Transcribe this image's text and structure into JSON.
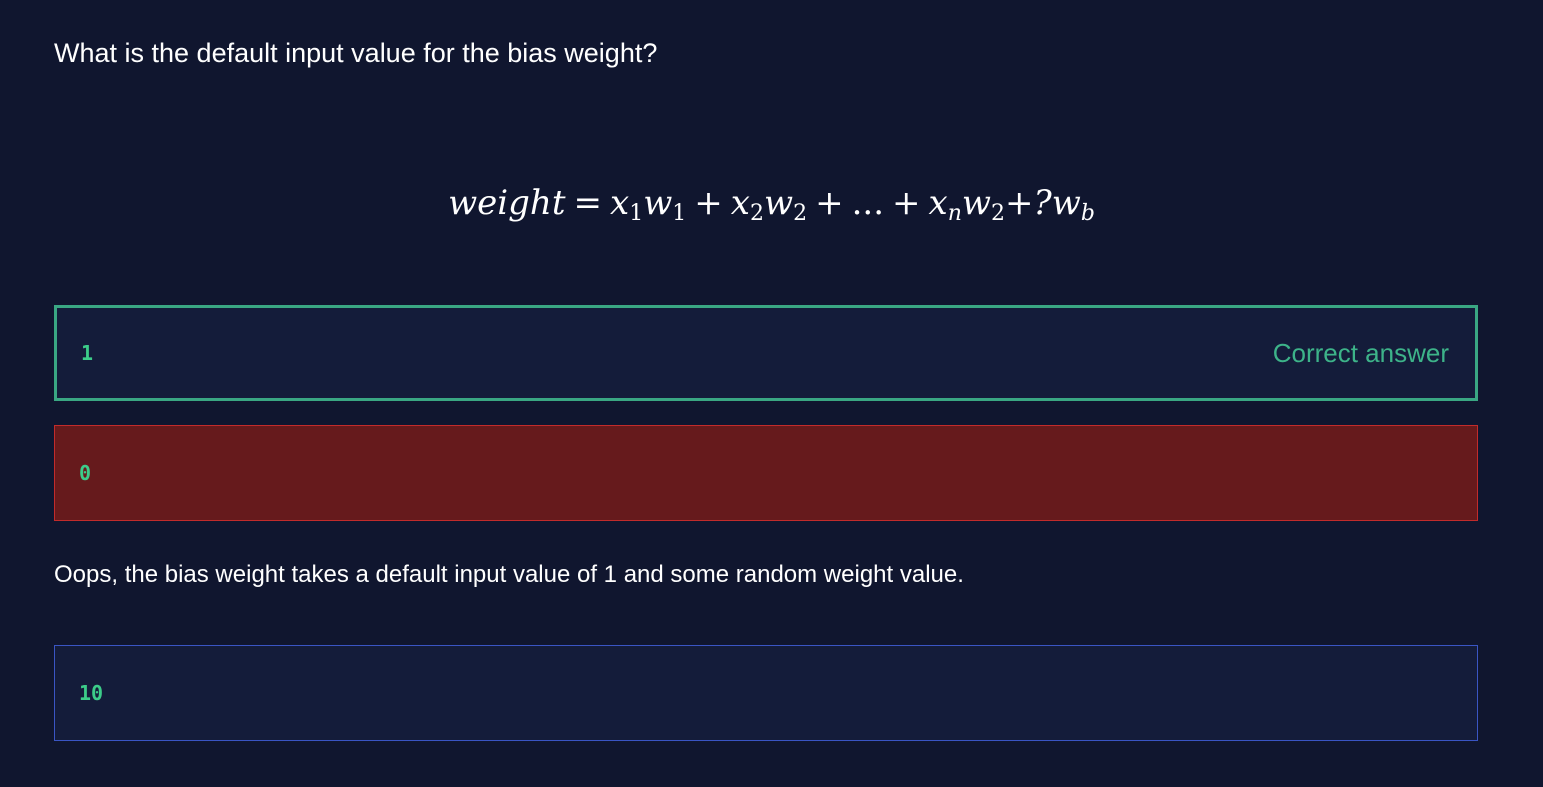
{
  "question": "What is the default input value for the bias weight?",
  "formula": {
    "lhs": "weight",
    "eq": "=",
    "terms": [
      {
        "x": "x",
        "xs": "1",
        "w": "w",
        "ws": "1"
      },
      {
        "x": "x",
        "xs": "2",
        "w": "w",
        "ws": "2"
      },
      {
        "dots": "..."
      },
      {
        "x": "x",
        "xs": "n",
        "w": "w",
        "ws": "2"
      }
    ],
    "plus": "+",
    "bias": "?w",
    "bias_sub": "b"
  },
  "options": [
    {
      "value": "1",
      "tag": "Correct answer",
      "state": "correct"
    },
    {
      "value": "0",
      "state": "incorrect"
    },
    {
      "value": "10",
      "state": "neutral"
    }
  ],
  "feedback": "Oops, the bias weight takes a default input value of 1 and some random weight value.",
  "colors": {
    "background": "#10162f",
    "card": "#141c3a",
    "correct_border": "#3aa783",
    "wrong_bg": "#661a1c",
    "wrong_border": "#c22b2b",
    "neutral_border": "#3a55c4",
    "value_text": "#3ccc89"
  }
}
